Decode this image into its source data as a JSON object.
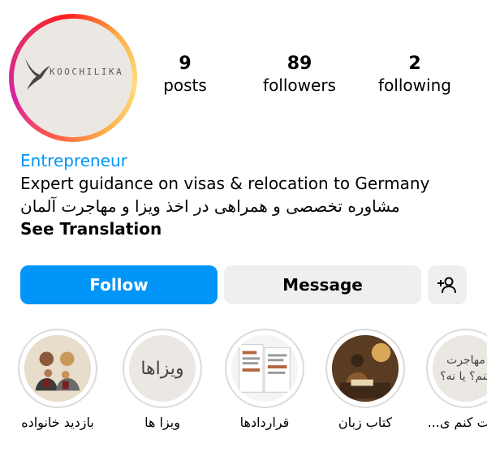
{
  "profile": {
    "avatar_text": "KOOCHILIKA",
    "stats": [
      {
        "count": "9",
        "label": "posts"
      },
      {
        "count": "89",
        "label": "followers"
      },
      {
        "count": "2",
        "label": "following"
      }
    ],
    "category": "Entrepreneur",
    "bio_line_1": "Expert guidance on visas & relocation to Germany",
    "bio_line_2": "مشاوره تخصصی و همراهی در اخذ ویزا و مهاجرت آلمان",
    "see_translation": "See Translation"
  },
  "actions": {
    "follow_label": "Follow",
    "message_label": "Message",
    "add_user_icon": "person-add-icon"
  },
  "highlights": [
    {
      "label": "بازدید خانواده",
      "cover": "family-photo"
    },
    {
      "label": "ویزا ها",
      "cover_text": "ویزاها"
    },
    {
      "label": "قراردادها",
      "cover": "documents-photo"
    },
    {
      "label": "کتاب زبان",
      "cover": "reading-photo"
    },
    {
      "label": "حرت کنم ی...",
      "cover_text_1": "مهاجرت",
      "cover_text_2": "کنم؟ یا نه؟"
    }
  ],
  "colors": {
    "accent": "#0095f6",
    "button_gray": "#efefef"
  }
}
